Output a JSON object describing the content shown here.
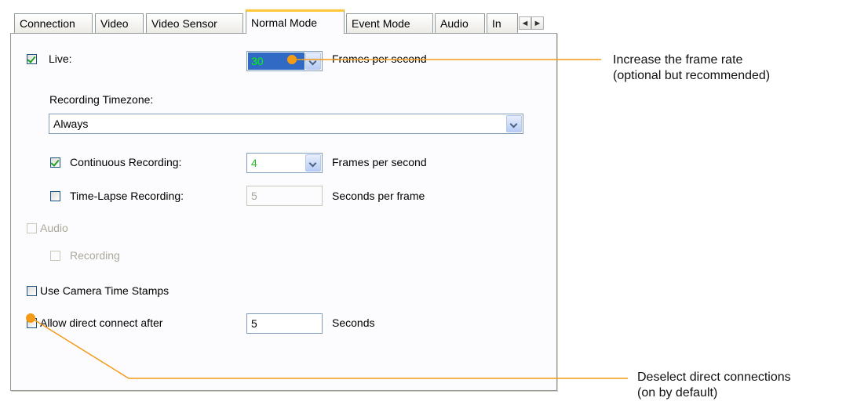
{
  "tabs": [
    {
      "label": "Connection",
      "active": false
    },
    {
      "label": "Video",
      "active": false
    },
    {
      "label": "Video Sensor",
      "active": false
    },
    {
      "label": "Normal Mode",
      "active": true
    },
    {
      "label": "Event Mode",
      "active": false
    },
    {
      "label": "Audio",
      "active": false
    },
    {
      "label": "In",
      "active": false
    }
  ],
  "tab_scroll": {
    "left": "◄",
    "right": "►"
  },
  "live": {
    "label": "Live:",
    "checked": true,
    "value": "30",
    "units": "Frames per second"
  },
  "timezone": {
    "label": "Recording Timezone:",
    "value": "Always"
  },
  "continuous": {
    "label": "Continuous Recording:",
    "checked": true,
    "value": "4",
    "units": "Frames per second"
  },
  "timelapse": {
    "label": "Time-Lapse Recording:",
    "checked": false,
    "value": "5",
    "units": "Seconds per frame"
  },
  "audio": {
    "label": "Audio",
    "checked": false,
    "enabled": false
  },
  "audio_recording": {
    "label": "Recording",
    "checked": false,
    "enabled": false
  },
  "camera_timestamps": {
    "label": "Use Camera Time Stamps",
    "checked": false
  },
  "direct_connect": {
    "label": "Allow direct connect after",
    "checked": false,
    "value": "5",
    "units": "Seconds"
  },
  "callouts": {
    "frame_rate": {
      "line1": "Increase the frame rate",
      "line2": "(optional but recommended)"
    },
    "direct": {
      "line1": "Deselect direct connections",
      "line2": "(on by default)"
    }
  },
  "colors": {
    "accent": "#f39a17",
    "selection": "#316ac5",
    "tab_highlight": "#ffc83c"
  }
}
